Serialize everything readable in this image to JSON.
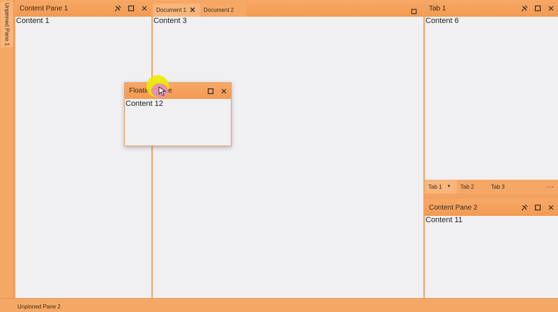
{
  "left_unpinned": {
    "label": "Unpinned Pane 1"
  },
  "bottom_unpinned": {
    "label": "Unpinned Pane 2"
  },
  "content_pane_1": {
    "title": "Content Pane 1",
    "content": "Content 1"
  },
  "documents": {
    "tabs": [
      {
        "label": "Document 1"
      },
      {
        "label": "Document 2"
      }
    ],
    "content": "Content 3"
  },
  "right_top": {
    "title": "Tab 1",
    "content": "Content 6",
    "tabs": [
      {
        "label": "Tab 1"
      },
      {
        "label": "Tab 2"
      },
      {
        "label": "Tab 3"
      }
    ],
    "more": "···"
  },
  "content_pane_2": {
    "title": "Content Pane 2",
    "content": "Content 11"
  },
  "floating_pane": {
    "title": "Floating Pane",
    "content": "Content 12"
  },
  "colors": {
    "accent": "#f29a52",
    "pane_bg": "#f0eff1"
  }
}
